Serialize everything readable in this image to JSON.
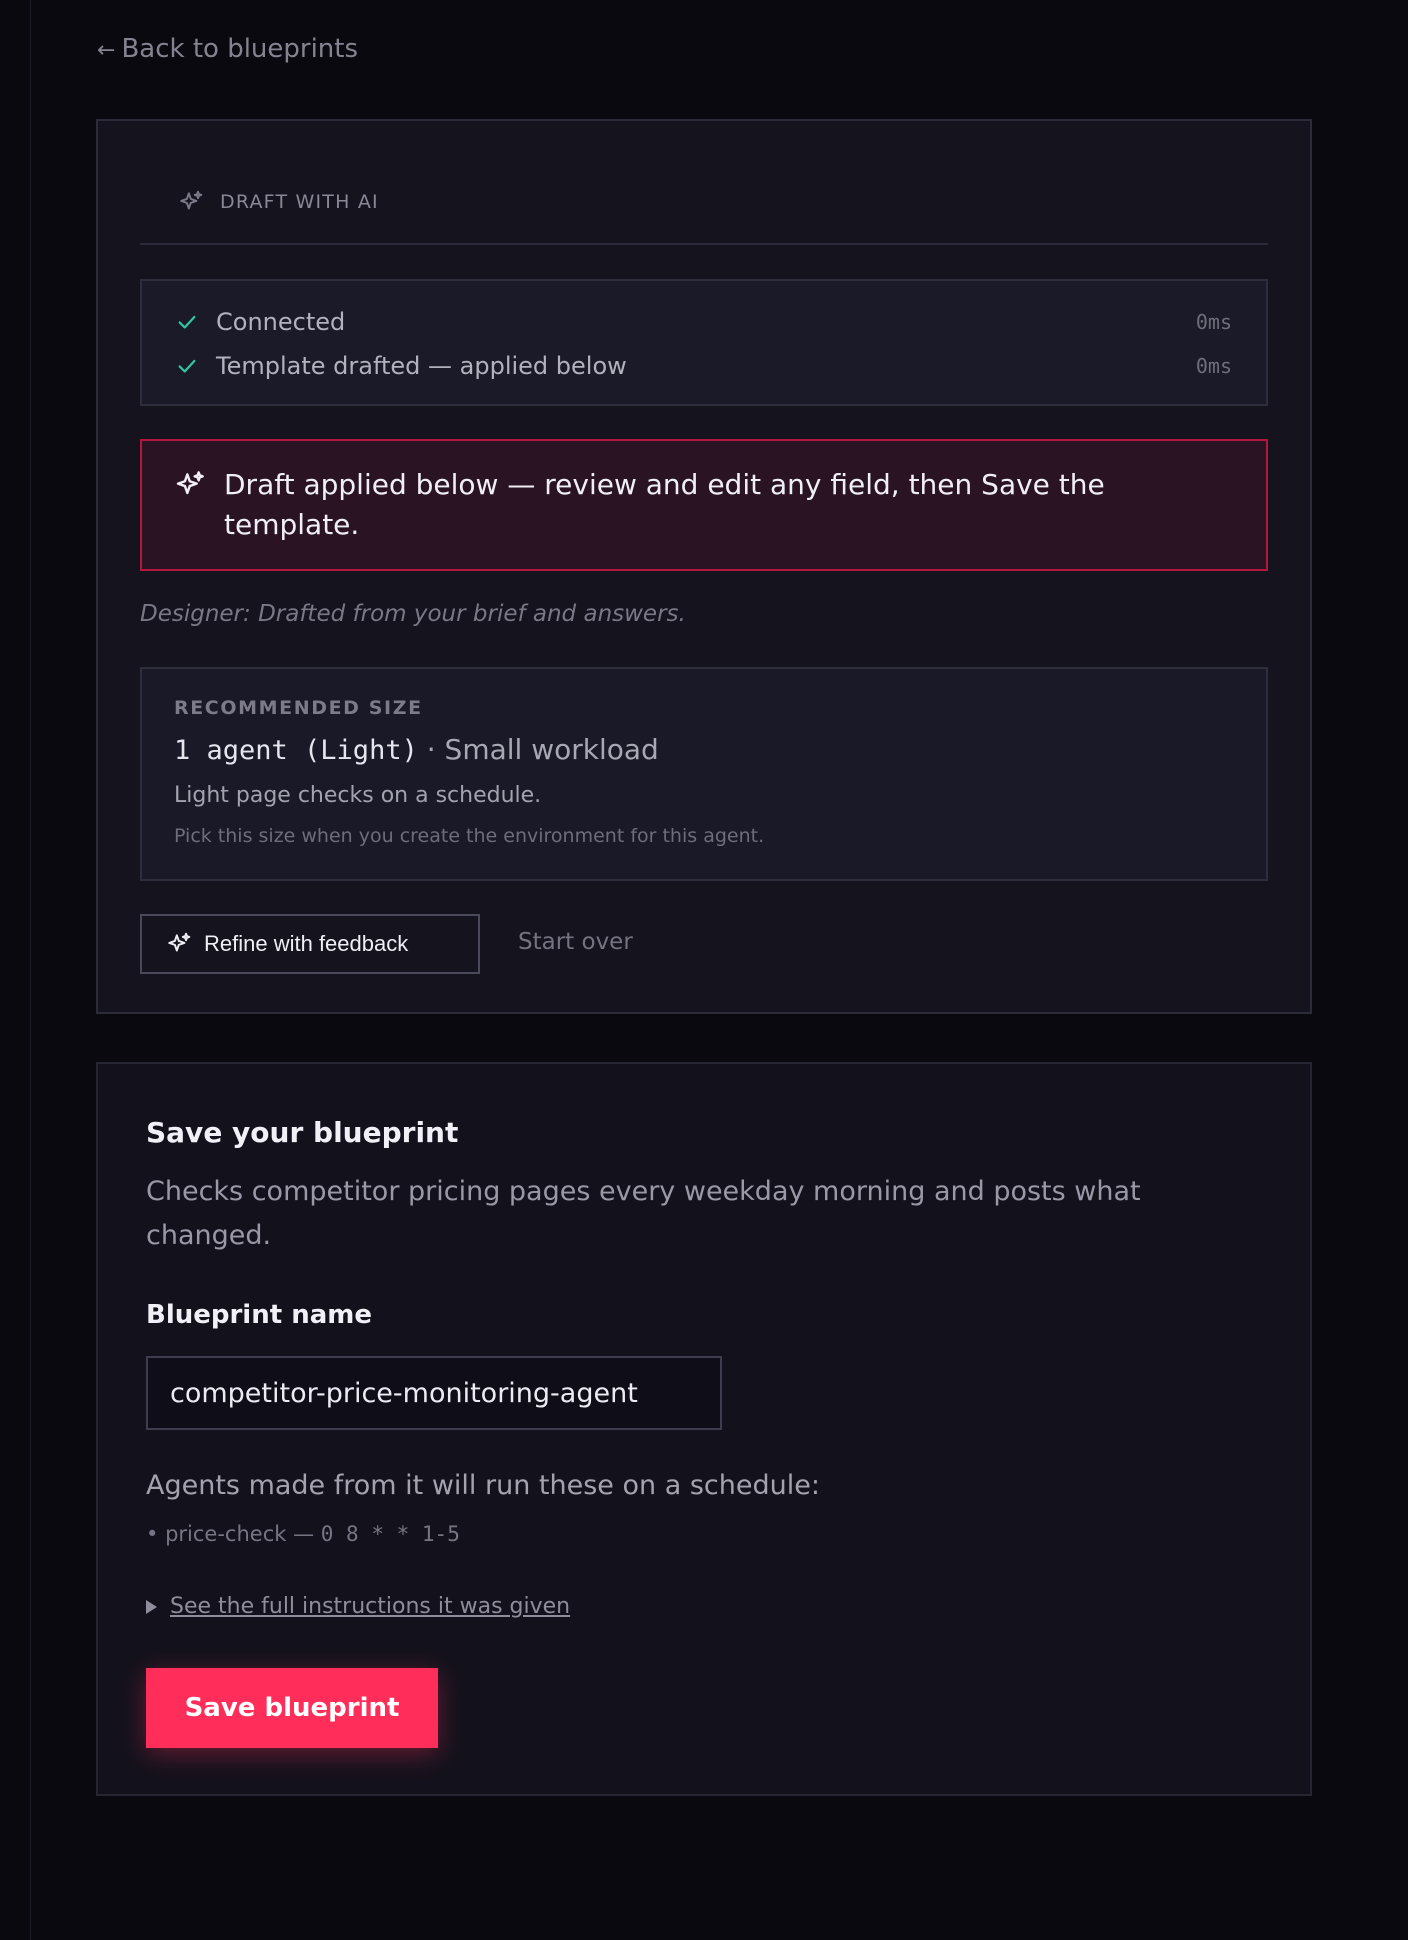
{
  "nav": {
    "back_arrow": "←",
    "back_label": "Back to blueprints"
  },
  "ai_panel": {
    "header_icon": "sparkles-icon",
    "header_label": "DRAFT WITH AI",
    "status_items": [
      {
        "label": "Connected",
        "time": "0ms",
        "icon": "check-icon"
      },
      {
        "label": "Template drafted — applied below",
        "time": "0ms",
        "icon": "check-icon"
      }
    ],
    "alert": {
      "icon": "sparkles-icon",
      "text": "Draft applied below — review and edit any field, then Save the template."
    },
    "designer_note": "Designer: Drafted from your brief and answers.",
    "recommended": {
      "eyebrow": "RECOMMENDED SIZE",
      "agent": "1 agent (Light)",
      "separator": " · ",
      "workload": "Small workload",
      "description": "Light page checks on a schedule.",
      "hint": "Pick this size when you create the environment for this agent."
    },
    "refine_label": "Refine with feedback",
    "start_over_label": "Start over"
  },
  "save_panel": {
    "title": "Save your blueprint",
    "description": "Checks competitor pricing pages every weekday morning and posts what changed.",
    "name_label": "Blueprint name",
    "name_value": "competitor-price-monitoring-agent",
    "schedule_intro": "Agents made from it will run these on a schedule:",
    "schedule": [
      {
        "bullet": "•",
        "name": "price-check",
        "dash": " — ",
        "cron": "0 8 * * 1-5"
      }
    ],
    "disclosure_label": "See the full instructions it was given",
    "save_label": "Save blueprint"
  },
  "colors": {
    "background": "#0a0910",
    "card": "#14131e",
    "accent": "#ff2d5a",
    "alert_border": "#b3173d",
    "success": "#2ec7a0"
  }
}
